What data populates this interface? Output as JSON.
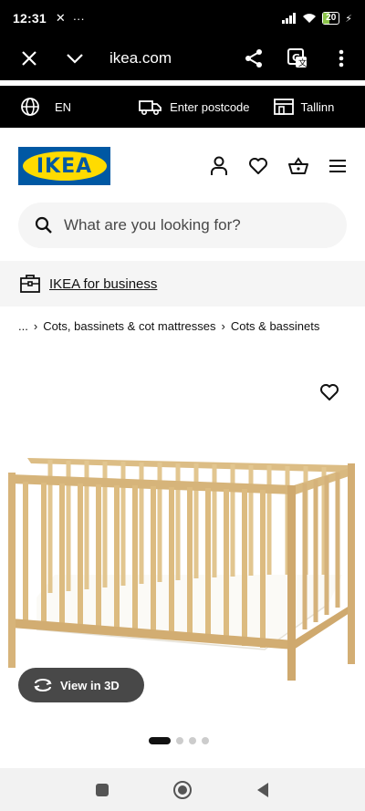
{
  "status": {
    "time": "12:31",
    "battery": "20"
  },
  "browser": {
    "url": "ikea.com"
  },
  "strip": {
    "language": "EN",
    "postcode": "Enter postcode",
    "store": "Tallinn"
  },
  "header": {
    "logo_text": "IKEA"
  },
  "search": {
    "placeholder": "What are you looking for?"
  },
  "business": {
    "label": "IKEA for business"
  },
  "breadcrumb": {
    "ellipsis": "...",
    "items": [
      "Cots, bassinets & cot mattresses",
      "Cots & bassinets"
    ]
  },
  "product": {
    "view3d_label": "View in 3D",
    "image_count": 4,
    "active_image": 1
  },
  "colors": {
    "brand_blue": "#0058a3",
    "brand_yellow": "#ffdb00"
  }
}
